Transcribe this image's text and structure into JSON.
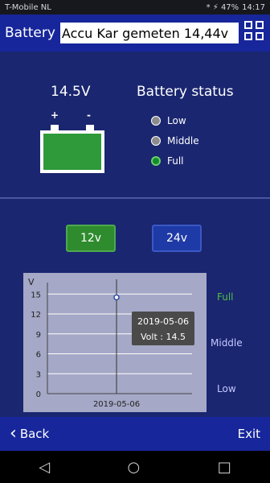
{
  "status_bar": {
    "carrier": "T-Mobile NL",
    "icons": "* ⚡ 47%",
    "time": "14:17"
  },
  "title_bar": {
    "title": "Battery",
    "input_value": "Accu Kar gemeten 14,44v",
    "qr_icon": "qr-code-icon"
  },
  "battery": {
    "voltage": "14.5V"
  },
  "battery_status": {
    "title": "Battery status",
    "items": [
      {
        "label": "Low",
        "active": false
      },
      {
        "label": "Middle",
        "active": false
      },
      {
        "label": "Full",
        "active": true
      }
    ]
  },
  "voltage_buttons": {
    "b12": "12v",
    "b24": "24v"
  },
  "chart_data": {
    "type": "line",
    "ylabel": "V",
    "yticks": [
      0,
      3,
      6,
      9,
      12,
      15
    ],
    "ylim": [
      0,
      16
    ],
    "x_label": "2019-05-06",
    "points": [
      {
        "x": "2019-05-06",
        "y": 14.5
      }
    ],
    "tooltip": {
      "date": "2019-05-06",
      "value_label": "Volt :",
      "value": "14.5"
    },
    "levels": [
      "Full",
      "Middle",
      "Low"
    ]
  },
  "bottom_bar": {
    "back": "Back",
    "exit": "Exit"
  },
  "nav": {
    "back_icon": "◁",
    "home_icon": "○",
    "recent_icon": "□"
  }
}
